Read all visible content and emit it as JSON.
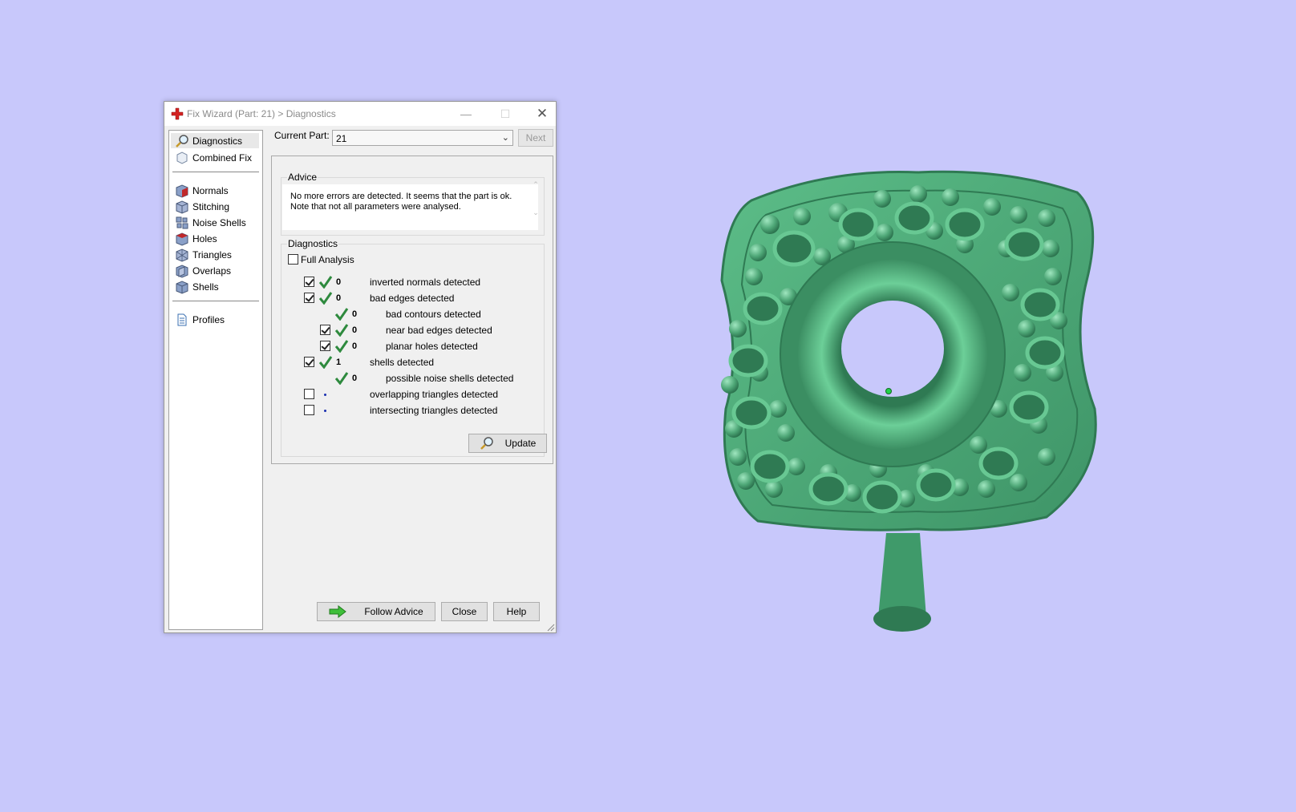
{
  "window": {
    "title": "Fix Wizard (Part: 21) > Diagnostics"
  },
  "sidebar": {
    "items": [
      {
        "label": "Diagnostics",
        "icon": "magnifier-icon",
        "selected": true
      },
      {
        "label": "Combined Fix",
        "icon": "cube-outline-icon"
      },
      {
        "label": "Normals",
        "icon": "normals-cube-icon"
      },
      {
        "label": "Stitching",
        "icon": "stitching-cube-icon"
      },
      {
        "label": "Noise Shells",
        "icon": "noise-shells-icon"
      },
      {
        "label": "Holes",
        "icon": "holes-cube-icon"
      },
      {
        "label": "Triangles",
        "icon": "triangles-cube-icon"
      },
      {
        "label": "Overlaps",
        "icon": "overlaps-cube-icon"
      },
      {
        "label": "Shells",
        "icon": "shells-cube-icon"
      },
      {
        "label": "Profiles",
        "icon": "document-icon"
      }
    ]
  },
  "part": {
    "label": "Current Part:",
    "value": "21",
    "next_label": "Next"
  },
  "advice": {
    "title": "Advice",
    "line1": "No more errors are detected. It seems that the part is ok.",
    "line2": "Note that not all parameters were analysed."
  },
  "diagnostics": {
    "title": "Diagnostics",
    "full_analysis_label": "Full Analysis",
    "full_analysis_checked": false,
    "rows": [
      {
        "count": "0",
        "label": "inverted normals detected",
        "checked": true
      },
      {
        "count": "0",
        "label": "bad edges detected",
        "checked": true
      },
      {
        "count": "0",
        "label": "bad contours detected"
      },
      {
        "count": "0",
        "label": "near bad edges detected",
        "checked": true
      },
      {
        "count": "0",
        "label": "planar holes detected",
        "checked": true
      },
      {
        "count": "1",
        "label": "shells detected",
        "checked": true
      },
      {
        "count": "0",
        "label": "possible noise shells detected"
      },
      {
        "count": "",
        "label": "overlapping triangles detected",
        "checked": false
      },
      {
        "count": "",
        "label": "intersecting triangles detected",
        "checked": false
      }
    ],
    "update_label": "Update"
  },
  "footer": {
    "follow_label": "Follow Advice",
    "close_label": "Close",
    "help_label": "Help"
  },
  "colors": {
    "background": "#c8c8fb",
    "model_green": "#4fa878",
    "ok_check": "#2e8a3e",
    "dialog": "#f0f0f0"
  }
}
